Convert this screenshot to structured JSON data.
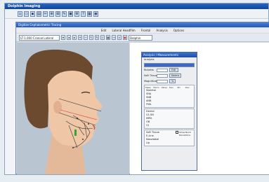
{
  "app": {
    "title": "Dolphin Imaging"
  },
  "doc": {
    "title": "Digitize Cephalometric Tracing",
    "menu": [
      "Edit",
      "Lateral Headfilm",
      "Frontal",
      "Analysis",
      "Options"
    ],
    "combo1": "LT-1.000 Cranial Lateral",
    "combo2": "Dolphin"
  },
  "dialog": {
    "title": "Analysis / Measurements",
    "group_label": "Analysis",
    "rows": [
      {
        "label": "Ricketts",
        "value": "",
        "btn": "Edit"
      },
      {
        "label": "Soft Tissue",
        "value": "",
        "btn": "Norms"
      },
      {
        "label": "Magnification",
        "value": "",
        "btn": "%"
      }
    ],
    "table_header": [
      "Meas",
      "Norm",
      "Value",
      "Dev",
      "SD",
      "Dev"
    ],
    "sections": [
      {
        "label": "Skeletal",
        "rows": [
          "SNA",
          "SNB",
          "ANB",
          "FMA"
        ]
      },
      {
        "label": "Dental",
        "rows": [
          "U1-SN",
          "IMPA",
          "OB",
          "OJ"
        ]
      },
      {
        "label": "Soft Tissue",
        "rows": [
          "E-Line",
          "Nasolabial",
          "Lip"
        ]
      }
    ],
    "checkbox_label": "Show Norm Deviations"
  },
  "colors": {
    "titlebar": "#1c56b8",
    "accent": "#3b67c9",
    "photo_bg": "#b9c6d2"
  },
  "icons": [
    "new-icon",
    "open-icon",
    "save-icon",
    "print-icon",
    "zoom-icon",
    "measure-icon",
    "trace-icon",
    "delete-icon"
  ]
}
